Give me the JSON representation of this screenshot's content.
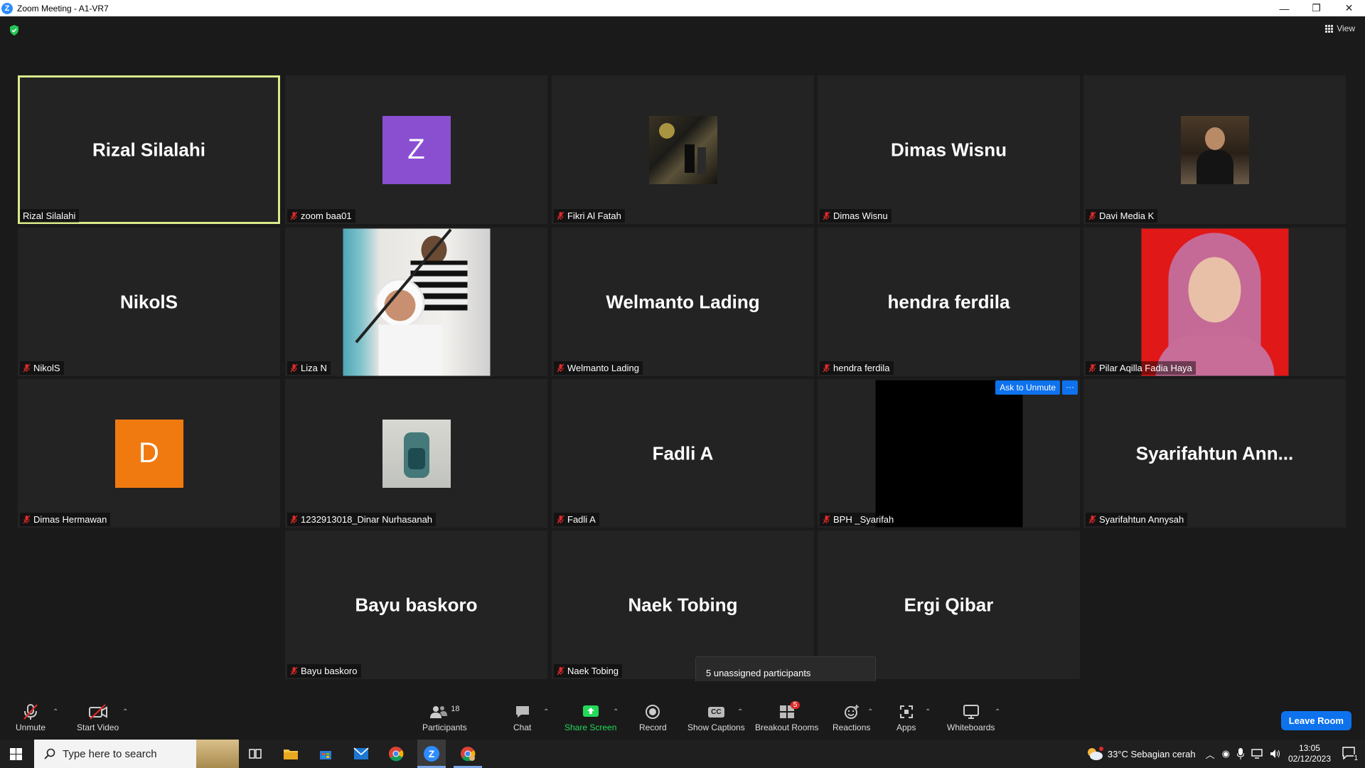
{
  "window": {
    "title": "Zoom Meeting - A1-VR7",
    "controls": {
      "minimize": "—",
      "restore": "❐",
      "close": "✕"
    }
  },
  "view_button": {
    "label": "View"
  },
  "tiles": [
    {
      "big": "Rizal Silalahi",
      "label": "Rizal Silalahi",
      "muted": false,
      "active": true
    },
    {
      "big": "",
      "label": "zoom baa01",
      "muted": true,
      "avatar_letter": "Z",
      "avatar_color": "#8a4fd0"
    },
    {
      "big": "",
      "label": "Fikri Al Fatah",
      "muted": true
    },
    {
      "big": "Dimas Wisnu",
      "label": "Dimas Wisnu",
      "muted": true
    },
    {
      "big": "",
      "label": "Davi Media K",
      "muted": true
    },
    {
      "big": "NikolS",
      "label": "NikolS",
      "muted": true
    },
    {
      "big": "",
      "label": "Liza N",
      "muted": true
    },
    {
      "big": "Welmanto Lading",
      "label": "Welmanto Lading",
      "muted": true
    },
    {
      "big": "hendra ferdila",
      "label": "hendra ferdila",
      "muted": true
    },
    {
      "big": "",
      "label": "Pilar Aqilla Fadia Haya",
      "muted": true
    },
    {
      "big": "",
      "label": "Dimas Hermawan",
      "muted": true,
      "avatar_letter": "D",
      "avatar_color": "#f07a10"
    },
    {
      "big": "",
      "label": "1232913018_Dinar Nurhasanah",
      "muted": true
    },
    {
      "big": "Fadli A",
      "label": "Fadli A",
      "muted": true
    },
    {
      "big": "",
      "label": "BPH _Syarifah",
      "muted": true,
      "ask_unmute": "Ask to Unmute",
      "more": "···"
    },
    {
      "big": "Syarifahtun  Ann...",
      "label": "Syarifahtun Annysah",
      "muted": true
    },
    {
      "big": "Bayu baskoro",
      "label": "Bayu baskoro",
      "muted": true
    },
    {
      "big": "Naek Tobing",
      "label": "Naek Tobing",
      "muted": true
    },
    {
      "big": "Ergi Qibar",
      "label": "",
      "muted": false
    }
  ],
  "tooltip": {
    "text": "5 unassigned participants"
  },
  "toolbar": {
    "unmute": "Unmute",
    "start_video": "Start Video",
    "participants": "Participants",
    "participants_count": "18",
    "chat": "Chat",
    "share_screen": "Share Screen",
    "record": "Record",
    "show_captions": "Show Captions",
    "captions_icon": "CC",
    "breakout_rooms": "Breakout Rooms",
    "breakout_badge": "5",
    "reactions": "Reactions",
    "apps": "Apps",
    "whiteboards": "Whiteboards",
    "leave_room": "Leave Room",
    "share_color": "#23d959"
  },
  "taskbar": {
    "search_placeholder": "Type here to search",
    "weather": "33°C  Sebagian cerah",
    "time": "13:05",
    "date": "02/12/2023",
    "notification_count": "1"
  }
}
